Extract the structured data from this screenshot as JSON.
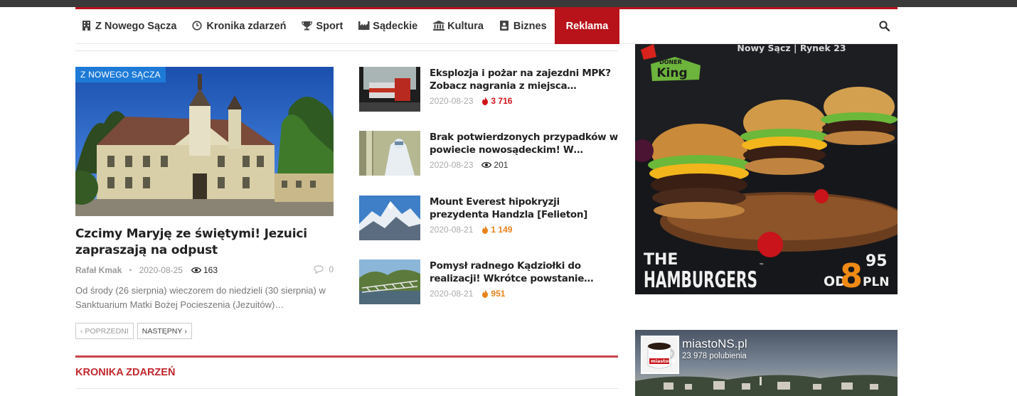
{
  "nav": {
    "items": [
      {
        "label": "Z Nowego Sącza",
        "icon": "building-icon"
      },
      {
        "label": "Kronika zdarzeń",
        "icon": "clock-icon"
      },
      {
        "label": "Sport",
        "icon": "trophy-icon"
      },
      {
        "label": "Sądeckie",
        "icon": "factory-icon"
      },
      {
        "label": "Kultura",
        "icon": "bank-icon"
      },
      {
        "label": "Biznes",
        "icon": "id-card-icon"
      }
    ],
    "active_label": "Reklama"
  },
  "featured": {
    "category": "Z NOWEGO SĄCZA",
    "title": "Czcimy Maryję ze świętymi! Jezuici zapraszają na odpust",
    "author": "Rafał Kmak",
    "date": "2020-08-25",
    "views": "163",
    "comments": "0",
    "excerpt": "Od środy (26 sierpnia) wieczorem do niedzieli (30 sierpnia) w Sanktuarium Matki Bożej Pocieszenia (Jezuitów)…"
  },
  "pager": {
    "prev": "POPRZEDNI",
    "next": "NASTĘPNY"
  },
  "side_posts": [
    {
      "title": "Eksplozja i pożar na zajezdni MPK? Zobacz nagrania z miejsca…",
      "date": "2020-08-23",
      "stat": "3 716",
      "stat_kind": "hot-red"
    },
    {
      "title": "Brak potwierdzonych przypadków w powiecie nowosądeckim! W…",
      "date": "2020-08-23",
      "stat": "201",
      "stat_kind": "views"
    },
    {
      "title": "Mount Everest hipokryzji prezydenta Handzla [Felieton]",
      "date": "2020-08-21",
      "stat": "1 149",
      "stat_kind": "hot-orange"
    },
    {
      "title": "Pomysł radnego Kądziołki do realizacji! Wkrótce powstanie…",
      "date": "2020-08-21",
      "stat": "951",
      "stat_kind": "hot-orange"
    }
  ],
  "section2": {
    "title": "KRONIKA ZDARZEŃ"
  },
  "ad": {
    "location": "Nowy Sącz | Rynek 23",
    "brand_top": "DONER",
    "brand_bottom": "King",
    "headline_1": "THE",
    "headline_2": "HAMBURGERS",
    "tm": "™",
    "price_prefix": "OD",
    "price_int": "8",
    "price_dec": "95",
    "price_currency": "PLN"
  },
  "facebook": {
    "page_name": "miastoNS.pl",
    "likes": "23 978 polubienia",
    "mug_text": "miastoNS"
  },
  "colors": {
    "accent_red": "#b8121a",
    "badge_blue": "#1d7ad6",
    "hot_red": "#d0121a",
    "hot_orange": "#e8831b"
  }
}
